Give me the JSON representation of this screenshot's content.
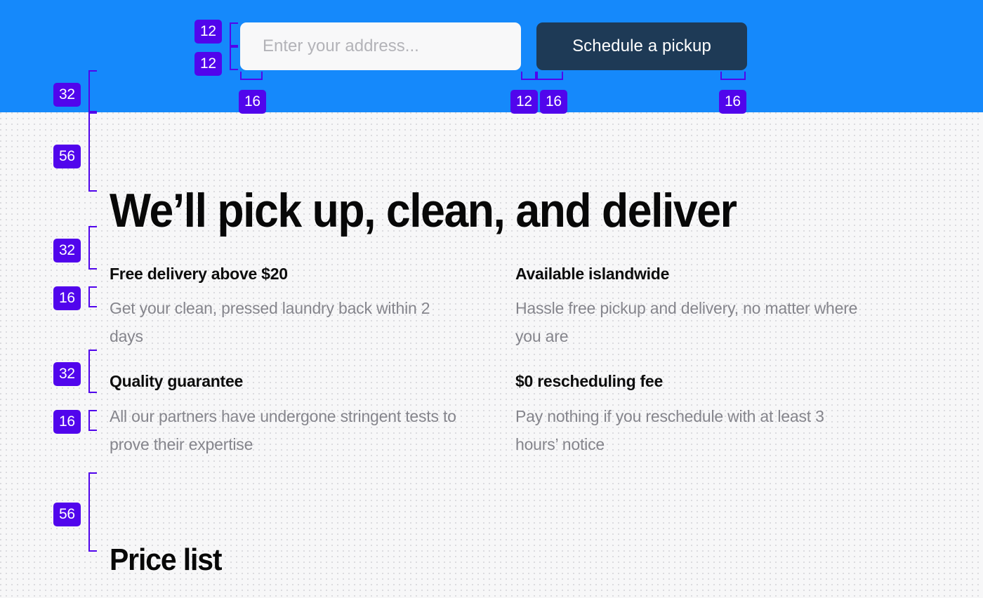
{
  "header": {
    "background_color": "#1589fb",
    "search": {
      "placeholder": "Enter your address...",
      "value": ""
    },
    "cta": {
      "label": "Schedule a pickup",
      "background_color": "#1e3a56"
    }
  },
  "main": {
    "headline": "We’ll pick up, clean, and deliver",
    "features": [
      [
        {
          "title": "Free delivery above $20",
          "desc": "Get your clean, pressed laundry back within 2 days"
        },
        {
          "title": "Available islandwide",
          "desc": "Hassle free pickup and delivery, no matter where you are"
        }
      ],
      [
        {
          "title": "Quality guarantee",
          "desc": "All our partners have undergone stringent tests to prove their expertise"
        },
        {
          "title": "$0 rescheduling fee",
          "desc": "Pay nothing if you reschedule with at least 3 hours’ notice"
        }
      ]
    ],
    "pricelist_heading": "Price list"
  },
  "annotations": {
    "badge_color": "#5105ec",
    "spacing_labels": [
      {
        "name": "input-top-padding",
        "value": "12"
      },
      {
        "name": "input-bottom-padding",
        "value": "12"
      },
      {
        "name": "header-below-input",
        "value": "32"
      },
      {
        "name": "input-left-inner",
        "value": "16"
      },
      {
        "name": "button-vertical-padding",
        "value": "12"
      },
      {
        "name": "button-left-padding",
        "value": "16"
      },
      {
        "name": "button-right-padding",
        "value": "16"
      },
      {
        "name": "header-to-headline",
        "value": "56"
      },
      {
        "name": "headline-to-features",
        "value": "32"
      },
      {
        "name": "feature-title-to-desc",
        "value": "16"
      },
      {
        "name": "features-row-gap",
        "value": "32"
      },
      {
        "name": "feature-title-to-desc-2",
        "value": "16"
      },
      {
        "name": "features-to-pricelist",
        "value": "56"
      }
    ]
  }
}
